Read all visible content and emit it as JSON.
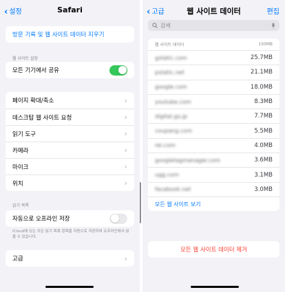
{
  "left": {
    "nav": {
      "back_label": "설정",
      "title": "Safari"
    },
    "clear_history_label": "방문 기록 및 웹 사이트 데이터 지우기",
    "website_settings_header": "웹 사이트 설정",
    "share_all_devices": {
      "label": "모든 기기에서 공유",
      "on": true
    },
    "settings_items": [
      {
        "label": "페이지 확대/축소"
      },
      {
        "label": "데스크탑 웹 사이트 요청"
      },
      {
        "label": "읽기 도구"
      },
      {
        "label": "카메라"
      },
      {
        "label": "마이크"
      },
      {
        "label": "위치"
      }
    ],
    "reading_list_header": "읽기 목록",
    "offline_save": {
      "label": "자동으로 오프라인 저장",
      "on": false
    },
    "offline_footnote": "iCloud에 있는 모든 읽기 목록 항목을 자동으로 저장하여 오프라인에서 읽을 수 있습니다.",
    "advanced_label": "고급"
  },
  "right": {
    "nav": {
      "back_label": "고급",
      "title": "웹 사이트 데이터",
      "edit_label": "편집"
    },
    "search": {
      "placeholder": "검색"
    },
    "list_header": {
      "label": "웹 사이트 데이터",
      "total": "150MB"
    },
    "sites": [
      {
        "domain": "gstatic.com",
        "size": "25.7MB"
      },
      {
        "domain": "pstatic.net",
        "size": "21.1MB"
      },
      {
        "domain": "google.com",
        "size": "18.0MB"
      },
      {
        "domain": "youtube.com",
        "size": "8.3MB"
      },
      {
        "domain": "digital.go.jp",
        "size": "7.7MB"
      },
      {
        "domain": "coupang.com",
        "size": "5.5MB"
      },
      {
        "domain": "rei.com",
        "size": "4.0MB"
      },
      {
        "domain": "googletagmanager.com",
        "size": "3.6MB"
      },
      {
        "domain": "ugg.com",
        "size": "3.1MB"
      },
      {
        "domain": "facebook.net",
        "size": "3.0MB"
      }
    ],
    "show_all_label": "모든 웹 사이트 보기",
    "remove_all_label": "모든 웹 사이트 데이터 제거"
  },
  "colors": {
    "accent": "#007aff",
    "toggle_on": "#34c759",
    "destructive": "#ff3b30"
  }
}
